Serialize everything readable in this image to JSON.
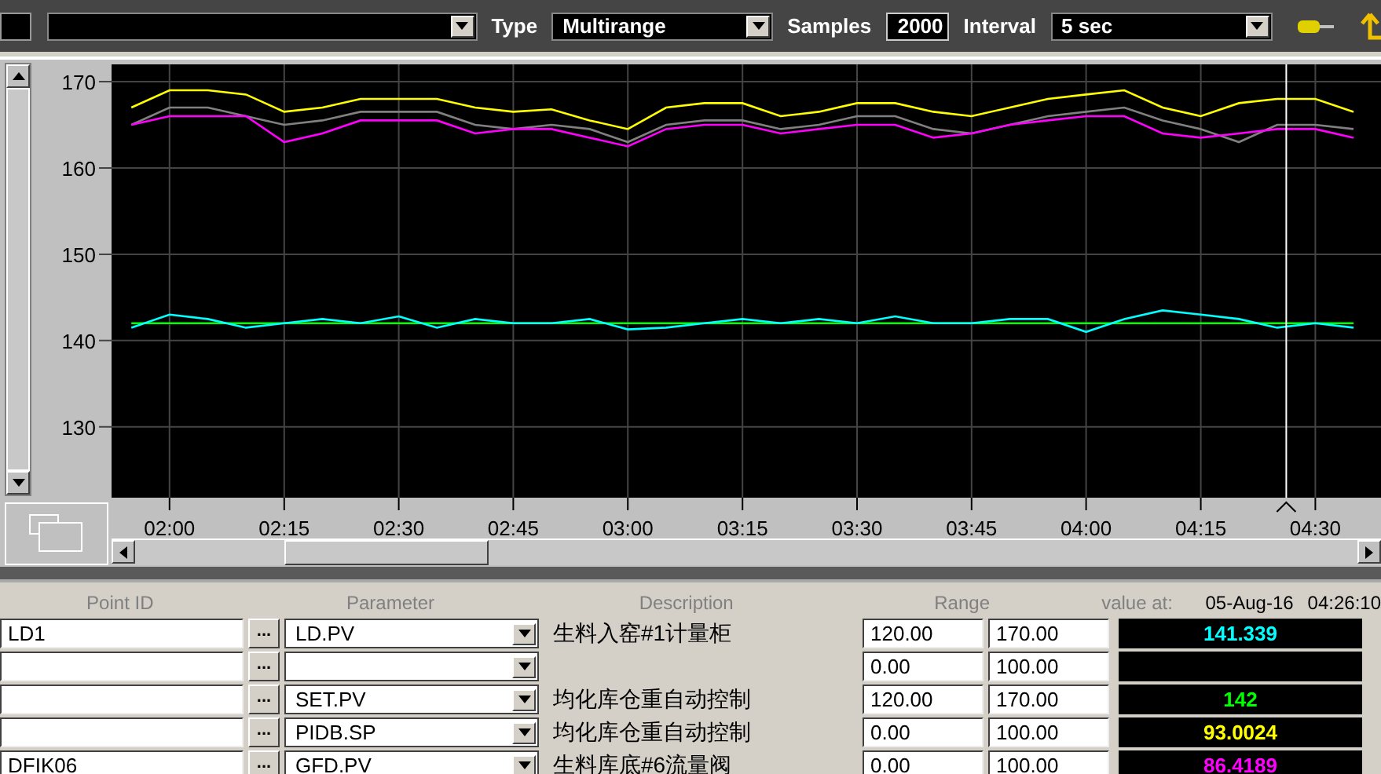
{
  "toolbar": {
    "type_label": "Type",
    "type_value": "Multirange",
    "samples_label": "Samples",
    "samples_value": "2000",
    "interval_label": "Interval",
    "interval_value": "5 sec"
  },
  "trend": {
    "chart_data": {
      "type": "line",
      "x": [
        115,
        120,
        125,
        130,
        135,
        140,
        145,
        150,
        155,
        160,
        165,
        170,
        175,
        180,
        185,
        190,
        195,
        200,
        205,
        210,
        215,
        220,
        225,
        230,
        235,
        240,
        245,
        250,
        255,
        260,
        265,
        270,
        275
      ],
      "xlim": [
        112.4,
        278.6
      ],
      "ylim": [
        121.8,
        172
      ],
      "xticks": [
        {
          "value": 120,
          "label": "02:00"
        },
        {
          "value": 135,
          "label": "02:15"
        },
        {
          "value": 150,
          "label": "02:30"
        },
        {
          "value": 165,
          "label": "02:45"
        },
        {
          "value": 180,
          "label": "03:00"
        },
        {
          "value": 195,
          "label": "03:15"
        },
        {
          "value": 210,
          "label": "03:30"
        },
        {
          "value": 225,
          "label": "03:45"
        },
        {
          "value": 240,
          "label": "04:00"
        },
        {
          "value": 255,
          "label": "04:15"
        },
        {
          "value": 270,
          "label": "04:30"
        }
      ],
      "yticks": [
        130,
        140,
        150,
        160,
        170
      ],
      "grid": true,
      "ref_lines": [
        {
          "axis": "x",
          "value": 266.2,
          "color": "#ffffff"
        }
      ],
      "series": [
        {
          "color": "#ffff00",
          "values": [
            167,
            169,
            169,
            168.5,
            166.5,
            167,
            168,
            168,
            168,
            167,
            166.5,
            166.8,
            165.5,
            164.5,
            167,
            167.5,
            167.5,
            166,
            166.5,
            167.5,
            167.5,
            166.5,
            166,
            167,
            168,
            168.5,
            169,
            167,
            166,
            167.5,
            168,
            168,
            166.5
          ]
        },
        {
          "color": "#808080",
          "values": [
            165,
            167,
            167,
            166,
            165,
            165.5,
            166.5,
            166.5,
            166.5,
            165,
            164.5,
            165,
            164.5,
            163,
            165,
            165.5,
            165.5,
            164.5,
            165,
            166,
            166,
            164.5,
            164,
            165,
            166,
            166.5,
            167,
            165.5,
            164.5,
            163,
            165,
            165,
            164.5
          ]
        },
        {
          "color": "#ff00ff",
          "values": [
            165,
            166,
            166,
            166,
            163,
            164,
            165.5,
            165.5,
            165.5,
            164,
            164.5,
            164.5,
            163.5,
            162.5,
            164.5,
            165,
            165,
            164,
            164.5,
            165,
            165,
            163.5,
            164,
            165,
            165.5,
            166,
            166,
            164,
            163.5,
            164,
            164.5,
            164.5,
            163.5
          ]
        },
        {
          "color": "#00ff00",
          "values": [
            142,
            142,
            142,
            142,
            142,
            142,
            142,
            142,
            142,
            142,
            142,
            142,
            142,
            142,
            142,
            142,
            142,
            142,
            142,
            142,
            142,
            142,
            142,
            142,
            142,
            142,
            142,
            142,
            142,
            142,
            142,
            142,
            142
          ]
        },
        {
          "color": "#00ffff",
          "values": [
            141.5,
            143,
            142.5,
            141.5,
            142,
            142.5,
            142,
            142.8,
            141.5,
            142.5,
            142,
            142,
            142.5,
            141.3,
            141.5,
            142,
            142.5,
            142,
            142.5,
            142,
            142.8,
            142,
            142,
            142.5,
            142.5,
            141,
            142.5,
            143.5,
            143,
            142.5,
            141.5,
            142,
            141.5
          ]
        }
      ]
    }
  },
  "table": {
    "columns": [
      "Point ID",
      "Parameter",
      "Description",
      "Range"
    ],
    "value_at_label": "value at:",
    "value_date": "05-Aug-16",
    "value_time": "04:26:10",
    "rows": [
      {
        "point_id": "LD1",
        "browse": "...",
        "parameter": "LD.PV",
        "description": "生料入窑#1计量柜",
        "range_low": "120.00",
        "range_high": "170.00",
        "value": "141.339",
        "color": "#00ffff"
      },
      {
        "point_id": "",
        "browse": "...",
        "parameter": "",
        "description": "",
        "range_low": "0.00",
        "range_high": "100.00",
        "value": ""
      },
      {
        "point_id": "",
        "browse": "...",
        "parameter": "SET.PV",
        "description": "均化库仓重自动控制",
        "range_low": "120.00",
        "range_high": "170.00",
        "value": "142",
        "color": "#00ff00"
      },
      {
        "point_id": "",
        "browse": "...",
        "parameter": "PIDB.SP",
        "description": "均化库仓重自动控制",
        "range_low": "0.00",
        "range_high": "100.00",
        "value": "93.0024",
        "color": "#ffff00"
      },
      {
        "point_id": "DFIK06",
        "browse": "...",
        "parameter": "GFD.PV",
        "description": "生料库底#6流量阀",
        "range_low": "0.00",
        "range_high": "100.00",
        "value": "86.4189",
        "color": "#ff00ff"
      }
    ]
  }
}
